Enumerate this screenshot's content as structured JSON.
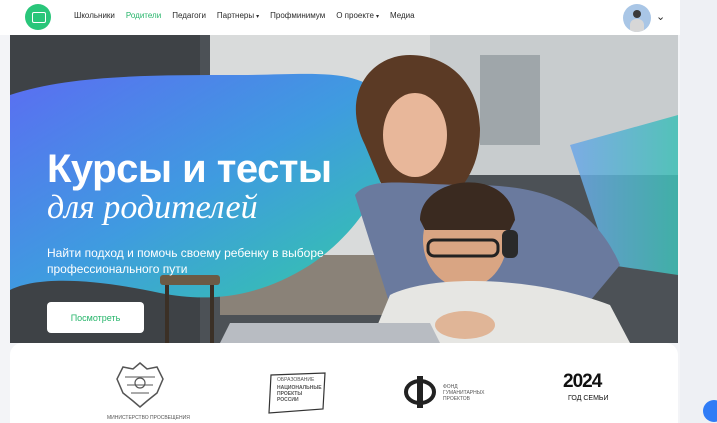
{
  "nav": {
    "items": [
      {
        "label": "Школьники",
        "active": false,
        "dropdown": false
      },
      {
        "label": "Родители",
        "active": true,
        "dropdown": false
      },
      {
        "label": "Педагоги",
        "active": false,
        "dropdown": false
      },
      {
        "label": "Партнеры",
        "active": false,
        "dropdown": true
      },
      {
        "label": "Профминимум",
        "active": false,
        "dropdown": false
      },
      {
        "label": "О проекте",
        "active": false,
        "dropdown": true
      },
      {
        "label": "Медиа",
        "active": false,
        "dropdown": false
      }
    ]
  },
  "hero": {
    "title_line1": "Курсы и тесты",
    "title_line2": "для родителей",
    "subtitle": "Найти подход и помочь своему ребенку в выборе профессионального пути",
    "button_label": "Посмотреть"
  },
  "partners": {
    "ministry_caption": "МИНИСТЕРСТВО ПРОСВЕЩЕНИЯ",
    "natproj_top": "ОБРАЗОВАНИЕ",
    "natproj_lines": [
      "НАЦИОНАЛЬНЫЕ",
      "ПРОЕКТЫ",
      "РОССИИ"
    ],
    "fond_lines": [
      "ФОНД",
      "ГУМАНИТАРНЫХ",
      "ПРОЕКТОВ"
    ],
    "year_big": "2024",
    "year_small": "ГОД СЕМЬИ"
  },
  "colors": {
    "accent": "#25b56a",
    "logo": "#29c67a",
    "gradient_blue": "#4a7ff0",
    "gradient_teal": "#37c6ad"
  }
}
